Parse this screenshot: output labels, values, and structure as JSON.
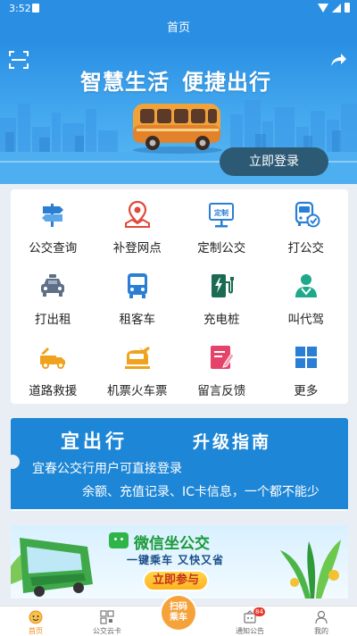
{
  "status_bar": {
    "time": "3:52"
  },
  "header": {
    "title": "首页"
  },
  "banner": {
    "slogan_1": "智慧生活",
    "slogan_2": "便捷出行",
    "login_label": "立即登录"
  },
  "services": [
    {
      "label": "公交查询",
      "icon": "signpost-icon",
      "color": "#2a7fd4"
    },
    {
      "label": "补登网点",
      "icon": "map-pin-icon",
      "color": "#e04a3a"
    },
    {
      "label": "定制公交",
      "icon": "sign-board-icon",
      "color": "#2a7fd4",
      "badge_text": "定制"
    },
    {
      "label": "打公交",
      "icon": "bus-hail-icon",
      "color": "#2a7fd4"
    },
    {
      "label": "打出租",
      "icon": "taxi-icon",
      "color": "#5f6f86"
    },
    {
      "label": "租客车",
      "icon": "coach-icon",
      "color": "#2a7fd4"
    },
    {
      "label": "充电桩",
      "icon": "charging-pile-icon",
      "color": "#1a9b6a"
    },
    {
      "label": "叫代驾",
      "icon": "driver-icon",
      "color": "#1fa88a"
    },
    {
      "label": "道路救援",
      "icon": "tow-truck-icon",
      "color": "#f0a21e"
    },
    {
      "label": "机票火车票",
      "icon": "train-plane-icon",
      "color": "#f0a21e"
    },
    {
      "label": "留言反馈",
      "icon": "feedback-icon",
      "color": "#e6436b"
    },
    {
      "label": "更多",
      "icon": "grid-more-icon",
      "color": "#2a7fd4"
    }
  ],
  "guide": {
    "title": "宜出行",
    "subtitle": "升级指南",
    "line1": "宜春公交行用户可直接登录",
    "line2": "余额、充值记录、IC卡信息，一个都不能少"
  },
  "wechat_banner": {
    "title": "微信坐公交",
    "subtitle": "一键乘车 又快又省",
    "cta": "立即参与"
  },
  "tabbar": {
    "items": [
      {
        "label": "首页",
        "active": true,
        "icon": "home-face-icon"
      },
      {
        "label": "公交云卡",
        "icon": "qr-card-icon"
      },
      {
        "label": "扫码乘车",
        "icon": "scan-center-icon"
      },
      {
        "label": "通知公告",
        "icon": "notice-icon",
        "badge": "84"
      },
      {
        "label": "我的",
        "icon": "profile-icon"
      }
    ]
  },
  "colors": {
    "primary": "#2a8fe3",
    "accent": "#f5a23b",
    "login_button": "#2c5a74"
  }
}
